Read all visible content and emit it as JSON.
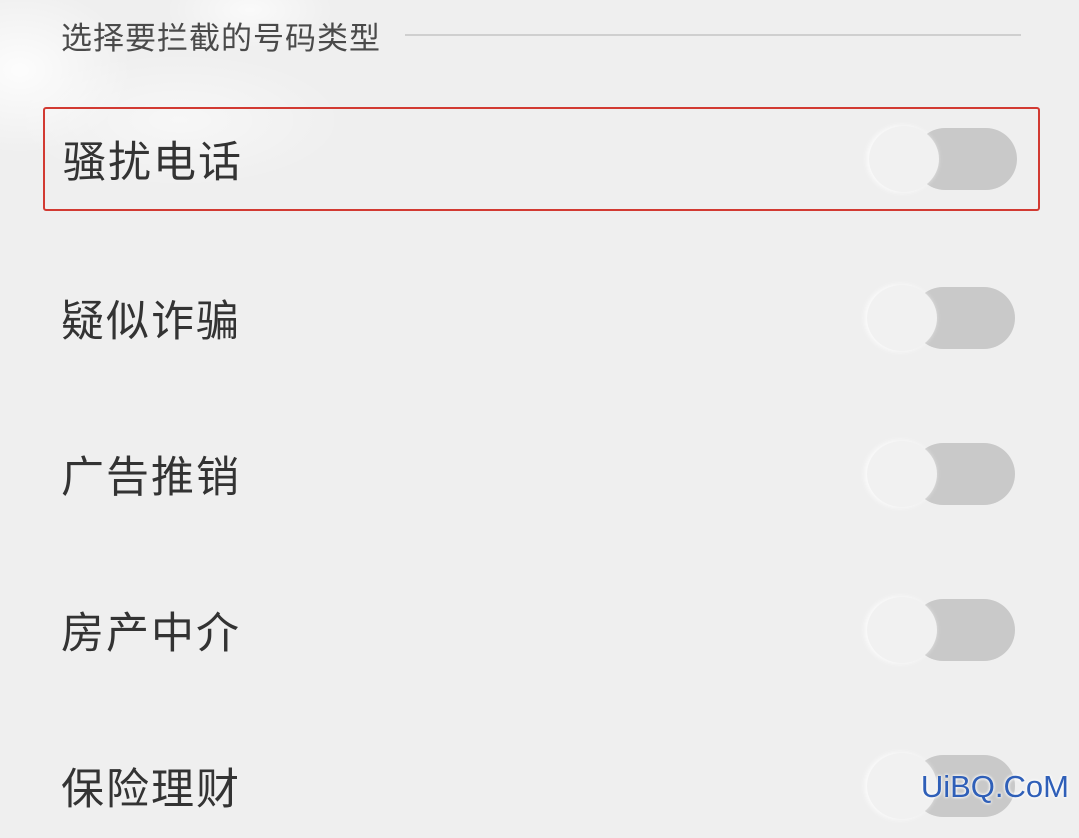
{
  "section": {
    "title": "选择要拦截的号码类型"
  },
  "items": [
    {
      "label": "骚扰电话",
      "enabled": false,
      "highlighted": true
    },
    {
      "label": "疑似诈骗",
      "enabled": false,
      "highlighted": false
    },
    {
      "label": "广告推销",
      "enabled": false,
      "highlighted": false
    },
    {
      "label": "房产中介",
      "enabled": false,
      "highlighted": false
    },
    {
      "label": "保险理财",
      "enabled": false,
      "highlighted": false
    }
  ],
  "watermark": {
    "text": "UiBQ.CoM"
  },
  "colors": {
    "background": "#efefef",
    "highlight_border": "#d23a32",
    "toggle_track_off": "#c9c9c9",
    "toggle_knob": "#f1f1f1",
    "watermark": "#2f5fb8"
  }
}
